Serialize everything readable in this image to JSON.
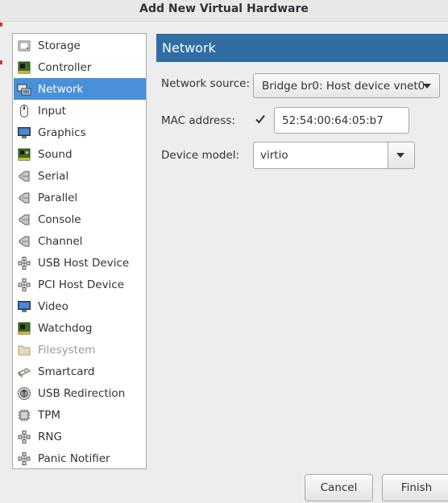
{
  "window": {
    "title": "Add New Virtual Hardware"
  },
  "sidebar": {
    "items": [
      {
        "label": "Storage",
        "icon": "storage-icon"
      },
      {
        "label": "Controller",
        "icon": "controller-icon"
      },
      {
        "label": "Network",
        "icon": "network-icon",
        "selected": true
      },
      {
        "label": "Input",
        "icon": "mouse-icon"
      },
      {
        "label": "Graphics",
        "icon": "monitor-icon"
      },
      {
        "label": "Sound",
        "icon": "sound-card-icon"
      },
      {
        "label": "Serial",
        "icon": "serial-icon"
      },
      {
        "label": "Parallel",
        "icon": "parallel-icon"
      },
      {
        "label": "Console",
        "icon": "console-icon"
      },
      {
        "label": "Channel",
        "icon": "channel-icon"
      },
      {
        "label": "USB Host Device",
        "icon": "usb-icon"
      },
      {
        "label": "PCI Host Device",
        "icon": "pci-icon"
      },
      {
        "label": "Video",
        "icon": "video-icon"
      },
      {
        "label": "Watchdog",
        "icon": "watchdog-icon"
      },
      {
        "label": "Filesystem",
        "icon": "folder-icon",
        "disabled": true
      },
      {
        "label": "Smartcard",
        "icon": "smartcard-icon"
      },
      {
        "label": "USB Redirection",
        "icon": "usb-redirection-icon"
      },
      {
        "label": "TPM",
        "icon": "chip-icon"
      },
      {
        "label": "RNG",
        "icon": "rng-icon"
      },
      {
        "label": "Panic Notifier",
        "icon": "panic-notifier-icon"
      }
    ]
  },
  "main": {
    "header": "Network",
    "network_source": {
      "label": "Network source:",
      "value": "Bridge br0: Host device vnet0"
    },
    "mac_address": {
      "label": "MAC address:",
      "checked": true,
      "value": "52:54:00:64:05:b7"
    },
    "device_model": {
      "label": "Device model:",
      "value": "virtio"
    }
  },
  "footer": {
    "cancel_label": "Cancel",
    "finish_label": "Finish"
  },
  "colors": {
    "selection": "#4a90d9",
    "header": "#2f6da3"
  }
}
